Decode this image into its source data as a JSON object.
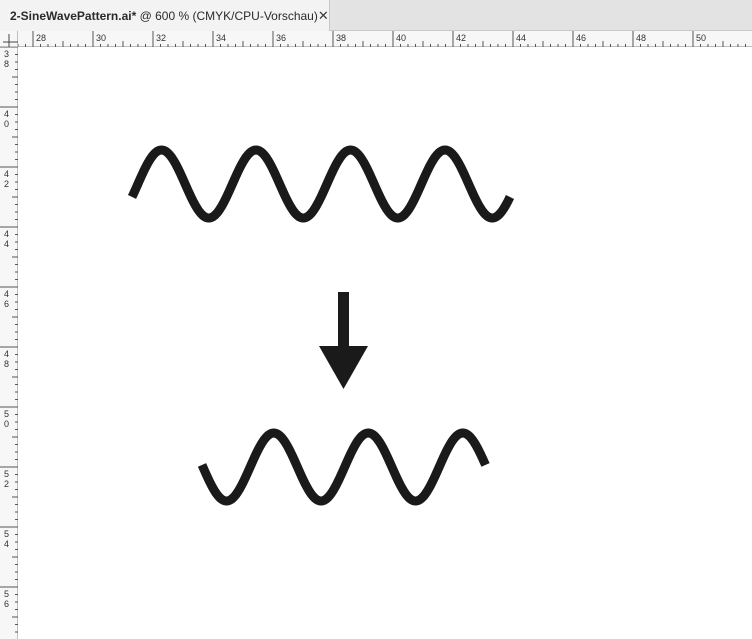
{
  "document_tab": {
    "filename": "2-SineWavePattern.ai*",
    "info": " @ 600 % (CMYK/CPU-Vorschau)",
    "close_glyph": "✕"
  },
  "ruler_horizontal": {
    "labels": [
      "28",
      "30",
      "32",
      "34",
      "36",
      "38",
      "40",
      "42",
      "44",
      "46",
      "48",
      "50"
    ]
  },
  "ruler_vertical": {
    "labels": [
      [
        "3",
        "8"
      ],
      [
        "4",
        "0"
      ],
      [
        "4",
        "2"
      ],
      [
        "4",
        "4"
      ],
      [
        "4",
        "6"
      ],
      [
        "4",
        "8"
      ],
      [
        "5",
        "0"
      ],
      [
        "5",
        "2"
      ],
      [
        "5",
        "4"
      ],
      [
        "5",
        "6"
      ]
    ]
  },
  "artwork": {
    "stroke_color": "#1a1a1a",
    "upper_wave_cycles": 4,
    "lower_wave_cycles": 3,
    "arrow_icon": "arrow-down-icon"
  }
}
